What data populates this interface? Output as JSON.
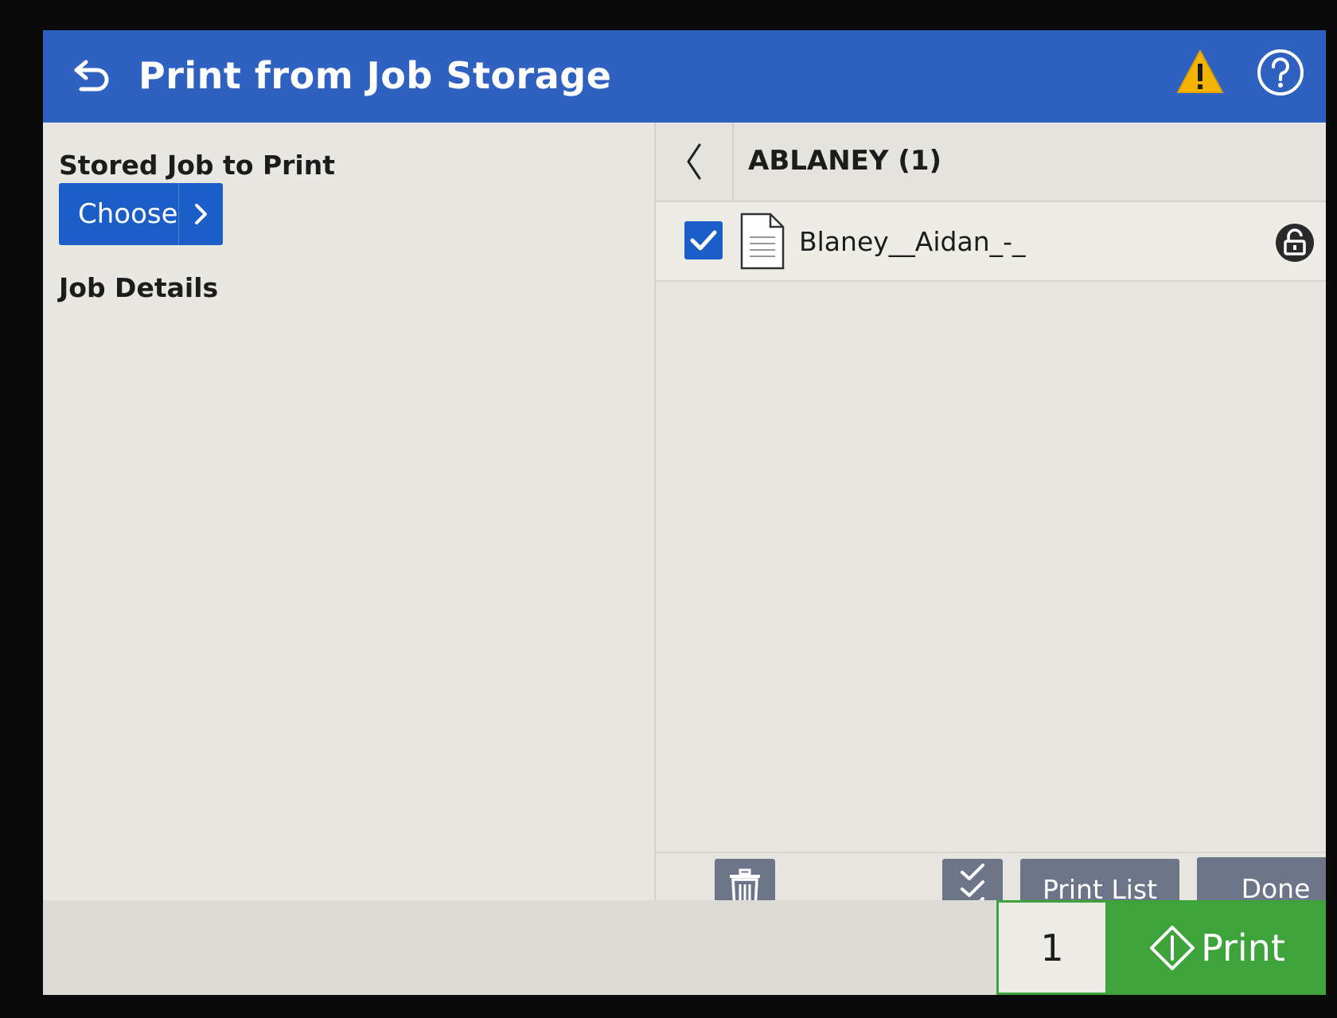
{
  "header": {
    "title": "Print from Job Storage"
  },
  "left": {
    "stored_job_label": "Stored Job to Print",
    "choose_label": "Choose",
    "job_details_label": "Job Details"
  },
  "right": {
    "folder_title": "ABLANEY (1)",
    "jobs": [
      {
        "name": "Blaney__Aidan_-_",
        "checked": true,
        "locked": true
      }
    ],
    "toolbar": {
      "print_list_label": "Print List",
      "done_label": "Done"
    }
  },
  "footer": {
    "copies": "1",
    "print_label": "Print"
  },
  "colors": {
    "header": "#2e61c0",
    "primary_button": "#1c5ec8",
    "print_green": "#3da33a",
    "toolbar_button": "#6c7688",
    "warning": "#f5b400"
  },
  "icons": [
    "back-arrow-icon",
    "warning-icon",
    "help-icon",
    "chevron-right-icon",
    "chevron-left-icon",
    "checkmark-icon",
    "document-icon",
    "lock-icon",
    "trash-icon",
    "select-all-icon",
    "start-diamond-icon"
  ]
}
